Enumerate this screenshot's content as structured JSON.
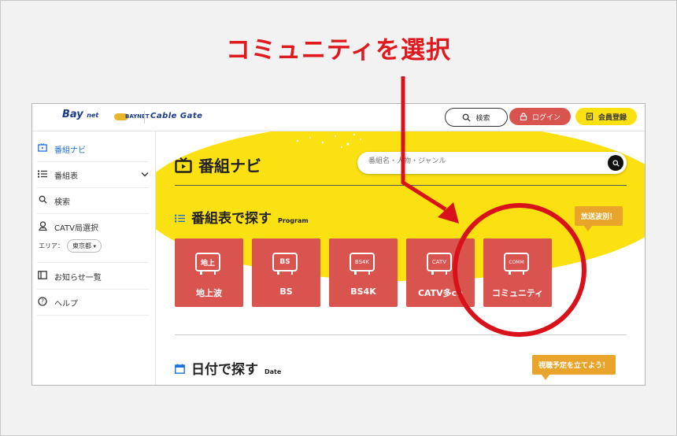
{
  "annotation": {
    "text": "コミュニティを選択"
  },
  "header": {
    "logo_bay": "Bay",
    "logo_net": "net",
    "logo_ring": "BAYNET",
    "logo_cablegate": "Cable Gate",
    "search_label": "検索",
    "login_label": "ログイン",
    "signup_label": "会員登録"
  },
  "sidebar": {
    "items": [
      {
        "label": "番組ナビ",
        "icon": "tv-icon"
      },
      {
        "label": "番組表",
        "icon": "list-icon"
      },
      {
        "label": "検索",
        "icon": "search-icon"
      },
      {
        "label": "CATV局選択",
        "icon": "user-pin-icon"
      },
      {
        "label": "お知らせ一覧",
        "icon": "book-icon"
      },
      {
        "label": "ヘルプ",
        "icon": "help-icon"
      }
    ],
    "area_label": "エリア：",
    "area_value": "東京都"
  },
  "main": {
    "title": "番組ナビ",
    "search_placeholder": "番組名・人物・ジャンル",
    "program_section": {
      "title": "番組表で探す",
      "en": "Program",
      "bubble": "放送波別！"
    },
    "tiles": [
      {
        "icon_text": "地上",
        "label": "地上波"
      },
      {
        "icon_text": "BS",
        "label": "BS"
      },
      {
        "icon_text": "BS4K",
        "label": "BS4K"
      },
      {
        "icon_text": "CATV",
        "label": "CATV多ch"
      },
      {
        "icon_text": "COMM",
        "label": "コミュニティ"
      }
    ],
    "date_section": {
      "title": "日付で探す",
      "en": "Date",
      "bubble": "視聴予定を立てよう！"
    }
  },
  "colors": {
    "annotation_red": "#e0191e",
    "brand_yellow": "#fbe012",
    "tile_red": "#d9534f",
    "bubble_orange": "#e9a52b",
    "link_blue": "#1f6fd8"
  }
}
